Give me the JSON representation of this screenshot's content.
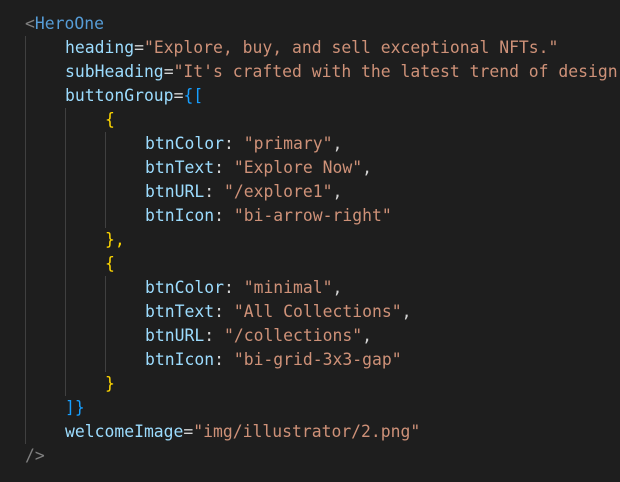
{
  "code": {
    "tag_open": "<",
    "tag_name": "HeroOne",
    "self_close": "/>",
    "heading_attr": "heading",
    "heading_value": "\"Explore, buy, and sell exceptional NFTs.\"",
    "subheading_attr": "subHeading",
    "subheading_value": "\"It's crafted with the latest trend of design",
    "buttongroup_attr": "buttonGroup",
    "buttongroup_open": "{[",
    "buttongroup_close": "]}",
    "obj_open": "{",
    "obj_close_comma": "},",
    "obj_close": "}",
    "equals": "=",
    "colon": ":",
    "comma": ",",
    "key_color": "btnColor",
    "key_text": "btnText",
    "key_url": "btnURL",
    "key_icon": "btnIcon",
    "buttons": [
      {
        "btnColor": "\"primary\"",
        "btnText": "\"Explore Now\"",
        "btnURL": "\"/explore1\"",
        "btnIcon": "\"bi-arrow-right\""
      },
      {
        "btnColor": "\"minimal\"",
        "btnText": "\"All Collections\"",
        "btnURL": "\"/collections\"",
        "btnIcon": "\"bi-grid-3x3-gap\""
      }
    ],
    "welcome_attr": "welcomeImage",
    "welcome_value": "\"img/illustrator/2.png\""
  },
  "colors": {
    "background": "#1e1e1e",
    "tag": "#569cd6",
    "attribute": "#9cdcfe",
    "string": "#ce9178",
    "bracket_level1": "#ffd700",
    "bracket_level2": "#da70d6",
    "bracket_level3": "#179fff"
  }
}
